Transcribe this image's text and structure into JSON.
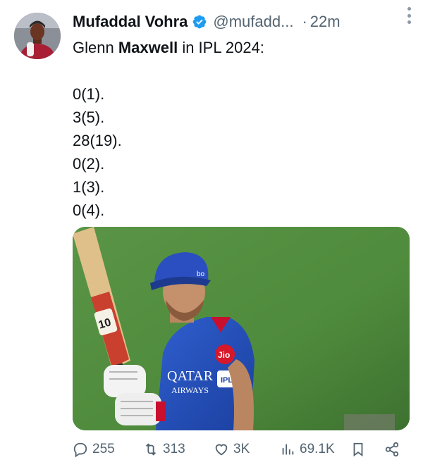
{
  "author": {
    "name": "Mufaddal Vohra",
    "handle": "@mufadd...",
    "separator": "·",
    "time": "22m",
    "avatar_icon": "avatar-portrait",
    "verified_color": "#1d9bf0"
  },
  "tweet": {
    "line1_pre": "Glenn ",
    "line1_bold": "Maxwell",
    "line1_post": " in IPL 2024:",
    "scores": [
      "0(1).",
      "3(5).",
      "28(19).",
      "0(2).",
      "1(3).",
      "0(4)."
    ]
  },
  "media": {
    "jersey_sponsor": "Jio",
    "jersey_text_1": "QATAR",
    "jersey_text_2": "AIRWAYS",
    "badge_text": "IPL",
    "bat_label": "10"
  },
  "actions": {
    "replies": "255",
    "reposts": "313",
    "likes": "3K",
    "views": "69.1K",
    "reply_icon": "reply-icon",
    "repost_icon": "repost-icon",
    "like_icon": "heart-icon",
    "views_icon": "views-icon",
    "bookmark_icon": "bookmark-icon",
    "share_icon": "share-icon"
  }
}
